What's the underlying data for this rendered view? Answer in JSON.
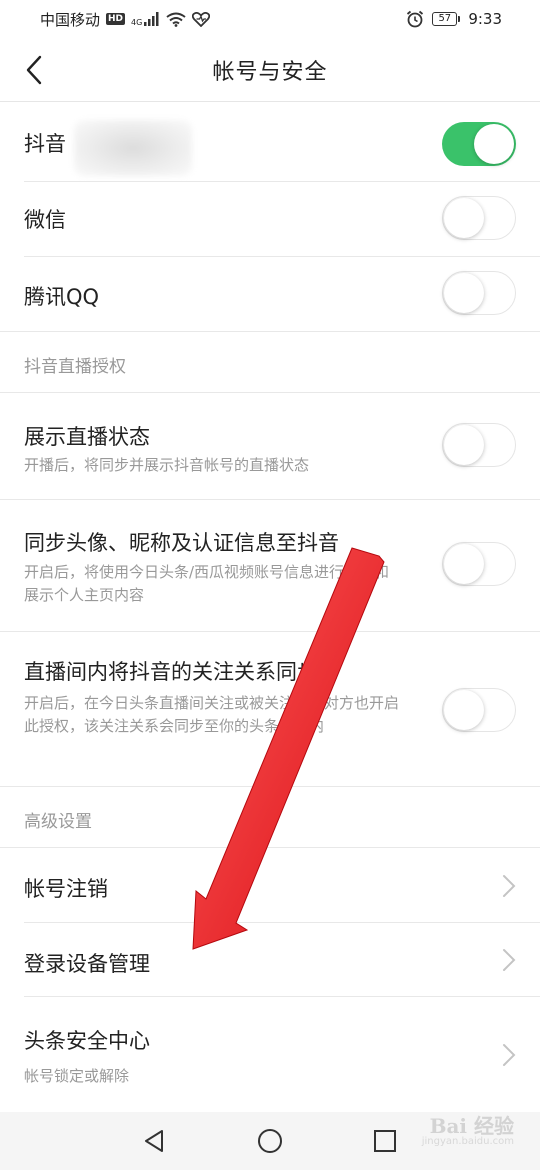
{
  "status_bar": {
    "carrier": "中国移动",
    "hd": "HD",
    "network": "4G",
    "battery": "57",
    "time": "9:33"
  },
  "header": {
    "title": "帐号与安全"
  },
  "bindings": [
    {
      "label": "抖音",
      "toggle": "on"
    },
    {
      "label": "微信",
      "toggle": "off"
    },
    {
      "label": "腾讯QQ",
      "toggle": "off"
    }
  ],
  "live_section": {
    "title": "抖音直播授权",
    "items": [
      {
        "label": "展示直播状态",
        "desc": "开播后，将同步并展示抖音帐号的直播状态",
        "toggle": "off"
      },
      {
        "label": "同步头像、昵称及认证信息至抖音",
        "desc": "开启后，将使用今日头条/西瓜视频账号信息进行开播和展示个人主页内容",
        "toggle": "off"
      },
      {
        "label": "直播间内将抖音的关注关系同步…",
        "desc": "开启后，在今日头条直播间关注或被关注，且对方也开启此授权，该关注关系会同步至你的头条账号内",
        "toggle": "off"
      }
    ]
  },
  "advanced_section": {
    "title": "高级设置",
    "items": [
      {
        "label": "帐号注销"
      },
      {
        "label": "登录设备管理"
      },
      {
        "label": "头条安全中心",
        "desc": "帐号锁定或解除"
      }
    ]
  },
  "watermark": {
    "text": "Bai 经验",
    "sub": "jingyan.baidu.com"
  },
  "colors": {
    "toggle_on": "#3ac26a",
    "annotation_arrow": "#e8141c"
  }
}
